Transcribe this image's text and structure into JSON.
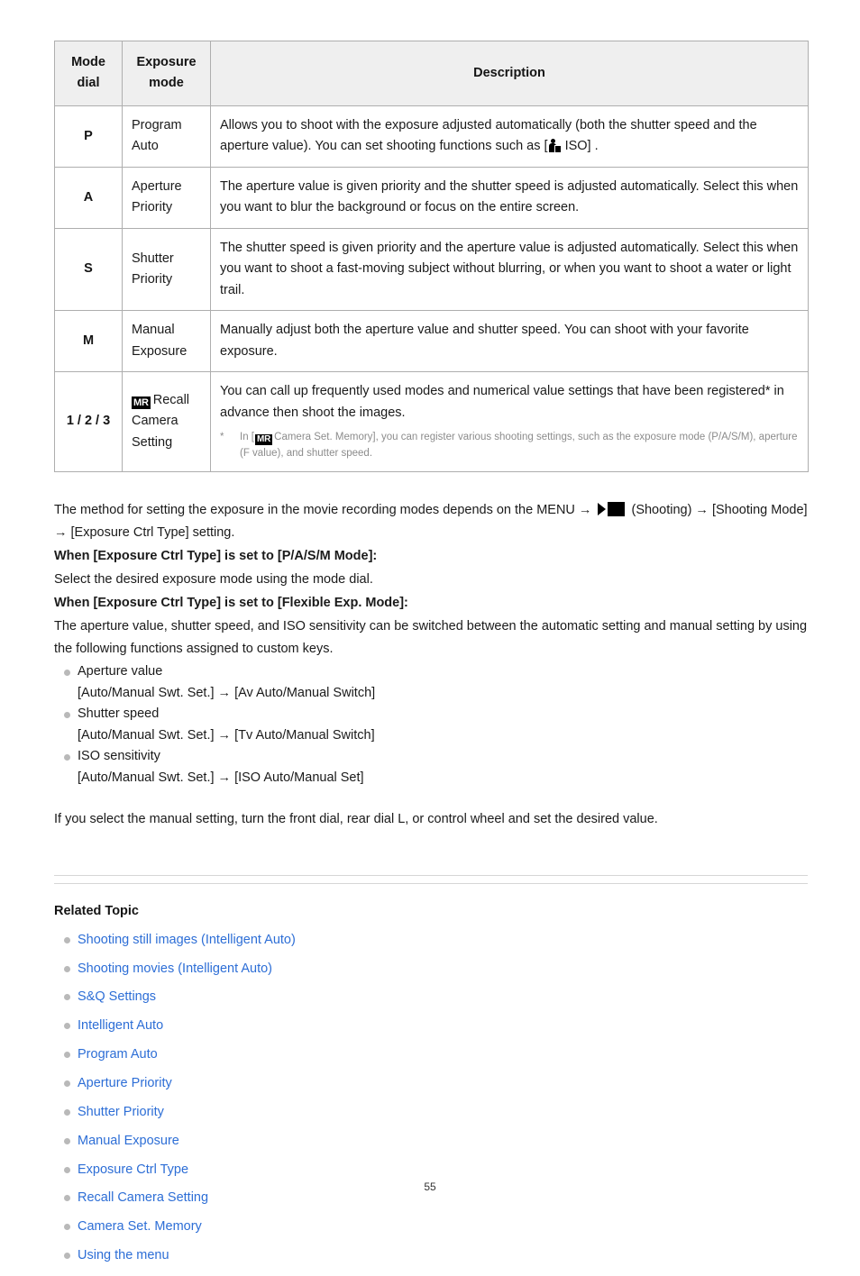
{
  "table": {
    "headers": {
      "mode_dial": "Mode\ndial",
      "mode_dial_line1": "Mode",
      "mode_dial_line2": "dial",
      "exposure_mode_line1": "Exposure",
      "exposure_mode_line2": "mode",
      "description": "Description"
    },
    "rows": [
      {
        "dial": "P",
        "mode_line1": "Program",
        "mode_line2": "Auto",
        "desc_part1": "Allows you to shoot with the exposure adjusted automatically (both the shutter speed and the aperture value). You can set shooting functions such as [",
        "desc_icon": "still-image-icon",
        "desc_part2": " ISO] ."
      },
      {
        "dial": "A",
        "mode_line1": "Aperture",
        "mode_line2": "Priority",
        "desc": "The aperture value is given priority and the shutter speed is adjusted automatically. Select this when you want to blur the background or focus on the entire screen."
      },
      {
        "dial": "S",
        "mode_line1": "Shutter",
        "mode_line2": "Priority",
        "desc": "The shutter speed is given priority and the aperture value is adjusted automatically. Select this when you want to shoot a fast-moving subject without blurring, or when you want to shoot a water or light trail."
      },
      {
        "dial": "M",
        "mode_line1": "Manual",
        "mode_line2": "Exposure",
        "desc": "Manually adjust both the aperture value and shutter speed. You can shoot with your favorite exposure."
      },
      {
        "dial": "1 / 2 / 3",
        "mr_badge": "MR",
        "mode_after_badge": "Recall",
        "mode_line2": "Camera",
        "mode_line3": "Setting",
        "desc": "You can call up frequently used modes and numerical value settings that have been registered* in advance then shoot the images.",
        "footnote_marker": "*",
        "footnote_part1": "In [",
        "footnote_badge": "MR",
        "footnote_part2": "Camera Set. Memory], you can register various shooting settings, such as the exposure mode (P/A/S/M), aperture (F value), and shutter speed."
      }
    ]
  },
  "body": {
    "intro_part1": "The method for setting the exposure in the movie recording modes depends on the MENU → ",
    "intro_icon": "movie-camera-icon",
    "intro_part2": " (Shooting) → [Shooting Mode] → [Exposure Ctrl Type] setting.",
    "heading_pasm": "When [Exposure Ctrl Type] is set to [P/A/S/M Mode]:",
    "text_pasm": "Select the desired exposure mode using the mode dial.",
    "heading_flexible": "When [Exposure Ctrl Type] is set to [Flexible Exp. Mode]:",
    "text_flexible": "The aperture value, shutter speed, and ISO sensitivity can be switched between the automatic setting and manual setting by using the following functions assigned to custom keys.",
    "functions": [
      {
        "label": "Aperture value",
        "path": "[Auto/Manual Swt. Set.] → [Av Auto/Manual Switch]"
      },
      {
        "label": "Shutter speed",
        "path": "[Auto/Manual Swt. Set.] → [Tv Auto/Manual Switch]"
      },
      {
        "label": "ISO sensitivity",
        "path": "[Auto/Manual Swt. Set.] → [ISO Auto/Manual Set]"
      }
    ],
    "closing": "If you select the manual setting, turn the front dial, rear dial L, or control wheel and set the desired value."
  },
  "related": {
    "title": "Related Topic",
    "links": [
      "Shooting still images (Intelligent Auto)",
      "Shooting movies (Intelligent Auto)",
      "S&Q Settings",
      "Intelligent Auto",
      "Program Auto",
      "Aperture Priority",
      "Shutter Priority",
      "Manual Exposure",
      "Exposure Ctrl Type",
      "Recall Camera Setting",
      "Camera Set. Memory",
      "Using the menu"
    ]
  },
  "footer": {
    "page_number": "55"
  },
  "colors": {
    "link": "#2d6ed6",
    "table_header_bg": "#efefef",
    "table_border": "#aeaeae",
    "bullet": "#b9b9b9",
    "footnote_text": "#8c8c8c",
    "rule": "#d6d6d6"
  }
}
